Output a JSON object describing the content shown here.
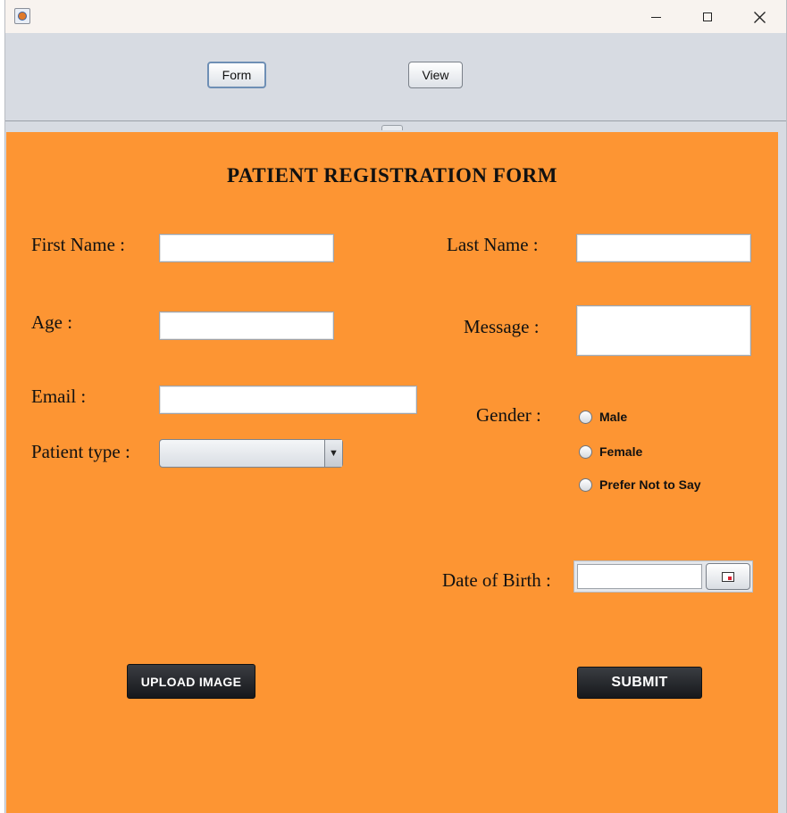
{
  "window": {
    "app_icon": "java-coffee-cup-icon",
    "controls": {
      "minimize": "minimize-icon",
      "maximize": "maximize-icon",
      "close": "close-icon"
    }
  },
  "toolbar": {
    "form_label": "Form",
    "view_label": "View"
  },
  "form": {
    "title": "PATIENT REGISTRATION FORM",
    "first_name_label": "First Name :",
    "first_name_value": "",
    "last_name_label": "Last Name :",
    "last_name_value": "",
    "age_label": "Age :",
    "age_value": "",
    "message_label": "Message :",
    "message_value": "",
    "email_label": "Email :",
    "email_value": "",
    "gender_label": "Gender :",
    "gender_options": [
      "Male",
      "Female",
      "Prefer Not to Say"
    ],
    "patient_type_label": "Patient type :",
    "patient_type_selected": "",
    "dob_label": "Date of Birth :",
    "dob_value": "",
    "upload_label": "UPLOAD IMAGE",
    "submit_label": "SUBMIT"
  },
  "colors": {
    "form_background": "#fd9533",
    "chrome_background": "#d7dbe2",
    "dark_button": "#1e2023"
  }
}
